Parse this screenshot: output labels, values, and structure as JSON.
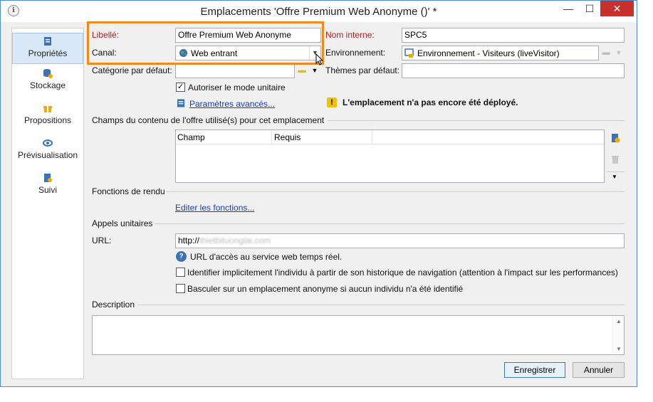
{
  "window": {
    "title": "Emplacements 'Offre Premium Web Anonyme ()' *",
    "minimize": "—",
    "maximize": "☐",
    "close": "✕"
  },
  "sidebar": {
    "items": [
      {
        "label": "Propriétés",
        "icon": "properties-icon",
        "selected": true
      },
      {
        "label": "Stockage",
        "icon": "storage-icon",
        "selected": false
      },
      {
        "label": "Propositions",
        "icon": "gift-icon",
        "selected": false
      },
      {
        "label": "Prévisualisation",
        "icon": "eye-icon",
        "selected": false
      },
      {
        "label": "Suivi",
        "icon": "tracking-icon",
        "selected": false
      }
    ]
  },
  "form": {
    "libelle_label": "Libellé:",
    "libelle_value": "Offre Premium Web Anonyme",
    "nom_interne_label": "Nom interne:",
    "nom_interne_value": "SPC5",
    "canal_label": "Canal:",
    "canal_value": "Web entrant",
    "environnement_label": "Environnement:",
    "environnement_value": "Environnement - Visiteurs (liveVisitor)",
    "categorie_label": "Catégorie par défaut:",
    "categorie_value": "",
    "themes_label": "Thèmes par défaut:",
    "themes_value": "",
    "autoriser_label": "Autoriser le mode unitaire",
    "autoriser_checked": true,
    "parametres_link": "Paramètres avancés...",
    "warning_text": "L'emplacement n'a pas encore été déployé."
  },
  "champs": {
    "section_title": "Champs du contenu de l'offre utilisé(s) pour cet emplacement",
    "columns": [
      "Champ",
      "Requis"
    ],
    "rows": []
  },
  "fonctions": {
    "section_title": "Fonctions de rendu",
    "edit_link": "Editer les fonctions..."
  },
  "appels": {
    "section_title": "Appels unitaires",
    "url_label": "URL:",
    "url_value": "http://",
    "url_blurred": "thietbituonglai.com",
    "url_help": "URL d'accès au service web temps réel.",
    "identify_label": "Identifier implicitement l'individu à partir de son historique de navigation (attention à l'impact sur les performances)",
    "identify_checked": false,
    "anonymous_label": "Basculer sur un emplacement anonyme si aucun individu n'a été identifié",
    "anonymous_checked": false
  },
  "description": {
    "label": "Description",
    "value": ""
  },
  "buttons": {
    "save": "Enregistrer",
    "cancel": "Annuler"
  },
  "colors": {
    "highlight": "#f08a1a",
    "required_label": "#c4161c",
    "link": "#1a3fb5",
    "close_button": "#c7312b"
  }
}
